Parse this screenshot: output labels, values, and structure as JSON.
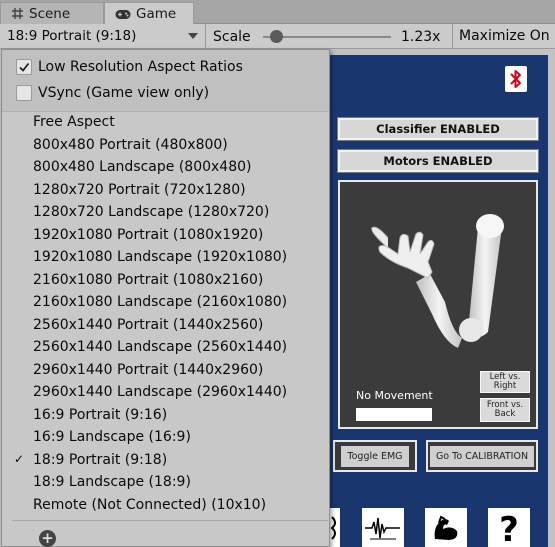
{
  "tabs": [
    {
      "label": "Scene",
      "icon": "grid-icon",
      "active": false
    },
    {
      "label": "Game",
      "icon": "gamepad-icon",
      "active": true
    }
  ],
  "toolbar": {
    "aspect_selected": "18:9 Portrait (9:18)",
    "scale_label": "Scale",
    "scale_value": "1.23x",
    "scale_fraction": 0.1,
    "maximize_label": "Maximize On"
  },
  "menu": {
    "low_res_label": "Low Resolution Aspect Ratios",
    "low_res_checked": true,
    "vsync_label": "VSync (Game view only)",
    "vsync_checked": false,
    "items": [
      {
        "label": "Free Aspect",
        "checked": false
      },
      {
        "label": "800x480 Portrait (480x800)",
        "checked": false
      },
      {
        "label": "800x480 Landscape (800x480)",
        "checked": false
      },
      {
        "label": "1280x720 Portrait (720x1280)",
        "checked": false
      },
      {
        "label": "1280x720 Landscape (1280x720)",
        "checked": false
      },
      {
        "label": "1920x1080 Portrait (1080x1920)",
        "checked": false
      },
      {
        "label": "1920x1080 Landscape (1920x1080)",
        "checked": false
      },
      {
        "label": "2160x1080 Portrait (1080x2160)",
        "checked": false
      },
      {
        "label": "2160x1080 Landscape (2160x1080)",
        "checked": false
      },
      {
        "label": "2560x1440 Portrait (1440x2560)",
        "checked": false
      },
      {
        "label": "2560x1440 Landscape (2560x1440)",
        "checked": false
      },
      {
        "label": "2960x1440 Portrait (1440x2960)",
        "checked": false
      },
      {
        "label": "2960x1440 Landscape (2960x1440)",
        "checked": false
      },
      {
        "label": "16:9 Portrait (9:16)",
        "checked": false
      },
      {
        "label": "16:9 Landscape (16:9)",
        "checked": false
      },
      {
        "label": "18:9 Portrait (9:18)",
        "checked": true
      },
      {
        "label": "18:9 Landscape (18:9)",
        "checked": false
      },
      {
        "label": "Remote (Not Connected) (10x10)",
        "checked": false
      }
    ],
    "check_glyph": "✓",
    "add_glyph": "+"
  },
  "game": {
    "classifier_label": "Classifier ENABLED",
    "motors_label": "Motors ENABLED",
    "no_movement_label": "No Movement",
    "left_right_label": "Left vs. Right",
    "front_back_label": "Front vs. Back",
    "toggle_emg_label": "Toggle EMG",
    "calibration_label": "Go To CALIBRATION",
    "background_color": "#19366f",
    "bluetooth_color": "#d0021b"
  }
}
